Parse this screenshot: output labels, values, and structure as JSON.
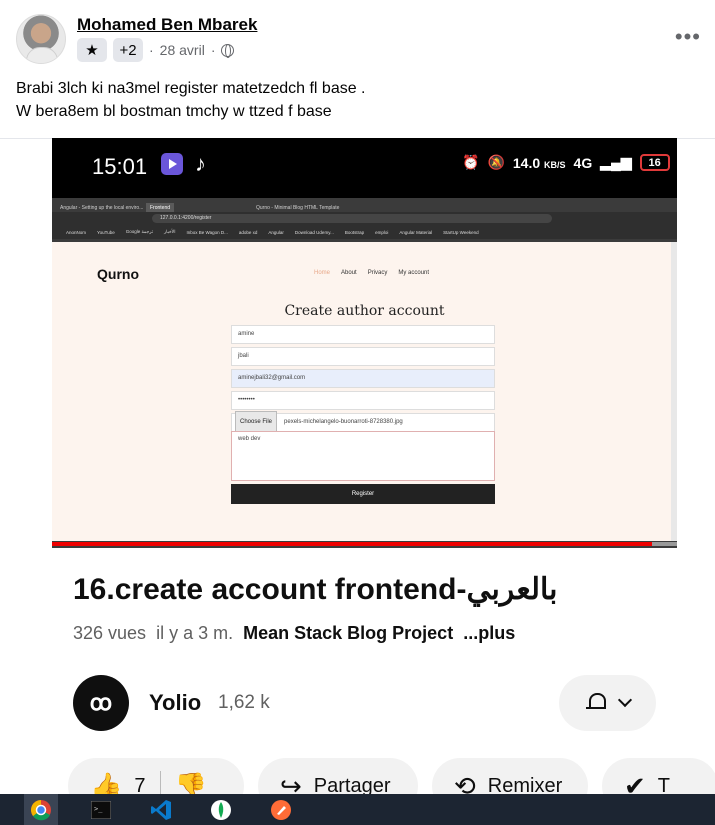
{
  "post": {
    "author": "Mohamed Ben Mbarek",
    "badge_count": "+2",
    "date": "28 avril",
    "separator": "·",
    "more_label": "•••",
    "text_line1": "Brabi 3lch ki na3mel register matetzedch fl base .",
    "text_line2": "W bera8em bl bostman tmchy w ttzed f base"
  },
  "phone_status": {
    "time": "15:01",
    "speed": "14.0",
    "speed_unit": "KB/S",
    "network": "4G",
    "battery": "16"
  },
  "browser": {
    "tab1": "Angular - Setting up the local enviro...",
    "tab2": "Frontend",
    "tab3": "Qurno - Minimal Blog HTML Template",
    "url": "127.0.0.1:4200/register",
    "bookmarks": [
      "AnonNom",
      "YouTube",
      "Google ترجمة",
      "ترجمة",
      "الأخبار",
      "Inbox Be Wagon D...",
      "adobe xd",
      "Angular",
      "Download Udemy...",
      "Bootstrap",
      "emploi",
      "Angular Material",
      "StartUp Weekend"
    ]
  },
  "webpage": {
    "brand": "Qurno",
    "nav": [
      "Home",
      "About",
      "Privacy",
      "My account"
    ],
    "form_title": "Create author account",
    "firstname_value": "amine",
    "lastname_value": "jbali",
    "email_value": "aminejbali32@gmail.com",
    "password_value": "••••••••",
    "file_button": "Choose File",
    "file_name": "pexels-michelangelo-buonarroti-8728380.jpg",
    "about_value": "web dev",
    "register_label": "Register"
  },
  "video": {
    "title": "16.create account frontend-بالعربي",
    "views": "326 vues",
    "age": "il y a 3 m.",
    "playlist": "Mean Stack Blog Project",
    "more": "...plus",
    "channel_initials": "ꝏ",
    "channel_name": "Yolio",
    "subscribers": "1,62 k",
    "likes": "7",
    "share_label": "Partager",
    "remix_label": "Remixer",
    "next_label": "T"
  },
  "progress_fraction": 0.96,
  "colors": {
    "accent_red": "#e00000",
    "nav_home": "#e8a889",
    "taskbar": "#1c2532"
  }
}
